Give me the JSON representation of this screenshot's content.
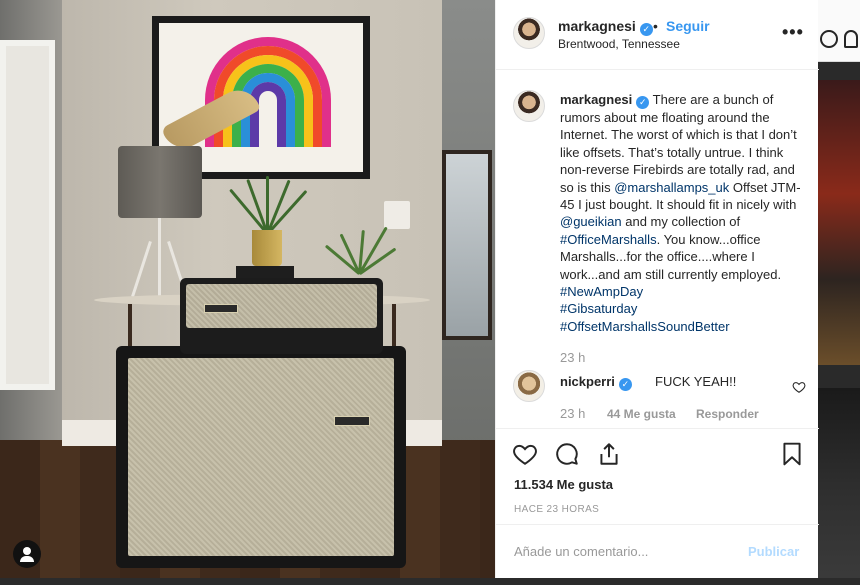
{
  "post": {
    "author": "markagnesi",
    "separator": "•",
    "follow_label": "Seguir",
    "location": "Brentwood, Tennessee",
    "more": "•••"
  },
  "caption": {
    "username": "markagnesi",
    "text_1": " There are a bunch of rumors about me floating around the Internet. The worst of which is that I don’t like offsets. That’s totally untrue. I think non-reverse Firebirds are totally rad, and so is this ",
    "mention_1": "@marshallamps_uk",
    "text_2": " Offset JTM-45 I just bought. It should fit in nicely with ",
    "mention_2": "@gueikian",
    "text_3": " and my collection of ",
    "hashtag_1": "#OfficeMarshalls",
    "text_4": ". You know...office Marshalls...for the office....where I work...and am still currently employed. ",
    "hashtag_2": "#NewAmpDay",
    "hashtag_3": "#Gibsaturday",
    "hashtag_4": "#OffsetMarshallsSoundBetter",
    "time": "23 h"
  },
  "comment": {
    "username": "nickperri",
    "text": "FUCK YEAH!!",
    "time": "23 h",
    "likes": "44 Me gusta",
    "reply_label": "Responder"
  },
  "stats": {
    "likes": "11.534 Me gusta",
    "posted_ago": "HACE 23 HORAS"
  },
  "add_comment": {
    "placeholder": "Añade un comentario...",
    "publish_label": "Publicar"
  },
  "colors": {
    "link": "#003569",
    "accent": "#3897f0",
    "publish_disabled": "#b3dbff"
  },
  "icons": [
    "verified-icon",
    "more-options-icon",
    "heart-icon",
    "comment-icon",
    "share-icon",
    "bookmark-icon",
    "user-tag-icon"
  ]
}
